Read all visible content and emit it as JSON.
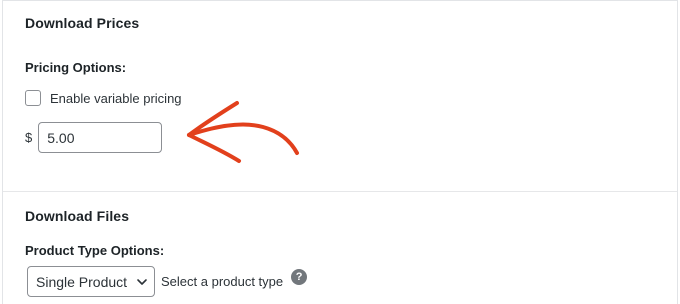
{
  "prices_section": {
    "title": "Download Prices",
    "pricing_options_label": "Pricing Options:",
    "variable_pricing": {
      "label": "Enable variable pricing",
      "checked": false
    },
    "currency_symbol": "$",
    "price_value": "5.00"
  },
  "files_section": {
    "title": "Download Files",
    "product_type_label": "Product Type Options:",
    "product_type_select": {
      "selected": "Single Product"
    },
    "hint": "Select a product type",
    "help_icon_glyph": "?"
  },
  "annotation": {
    "arrow_color": "#e2401c"
  },
  "icons": {
    "select": "chevron-down-icon",
    "help": "question-circle-icon"
  }
}
